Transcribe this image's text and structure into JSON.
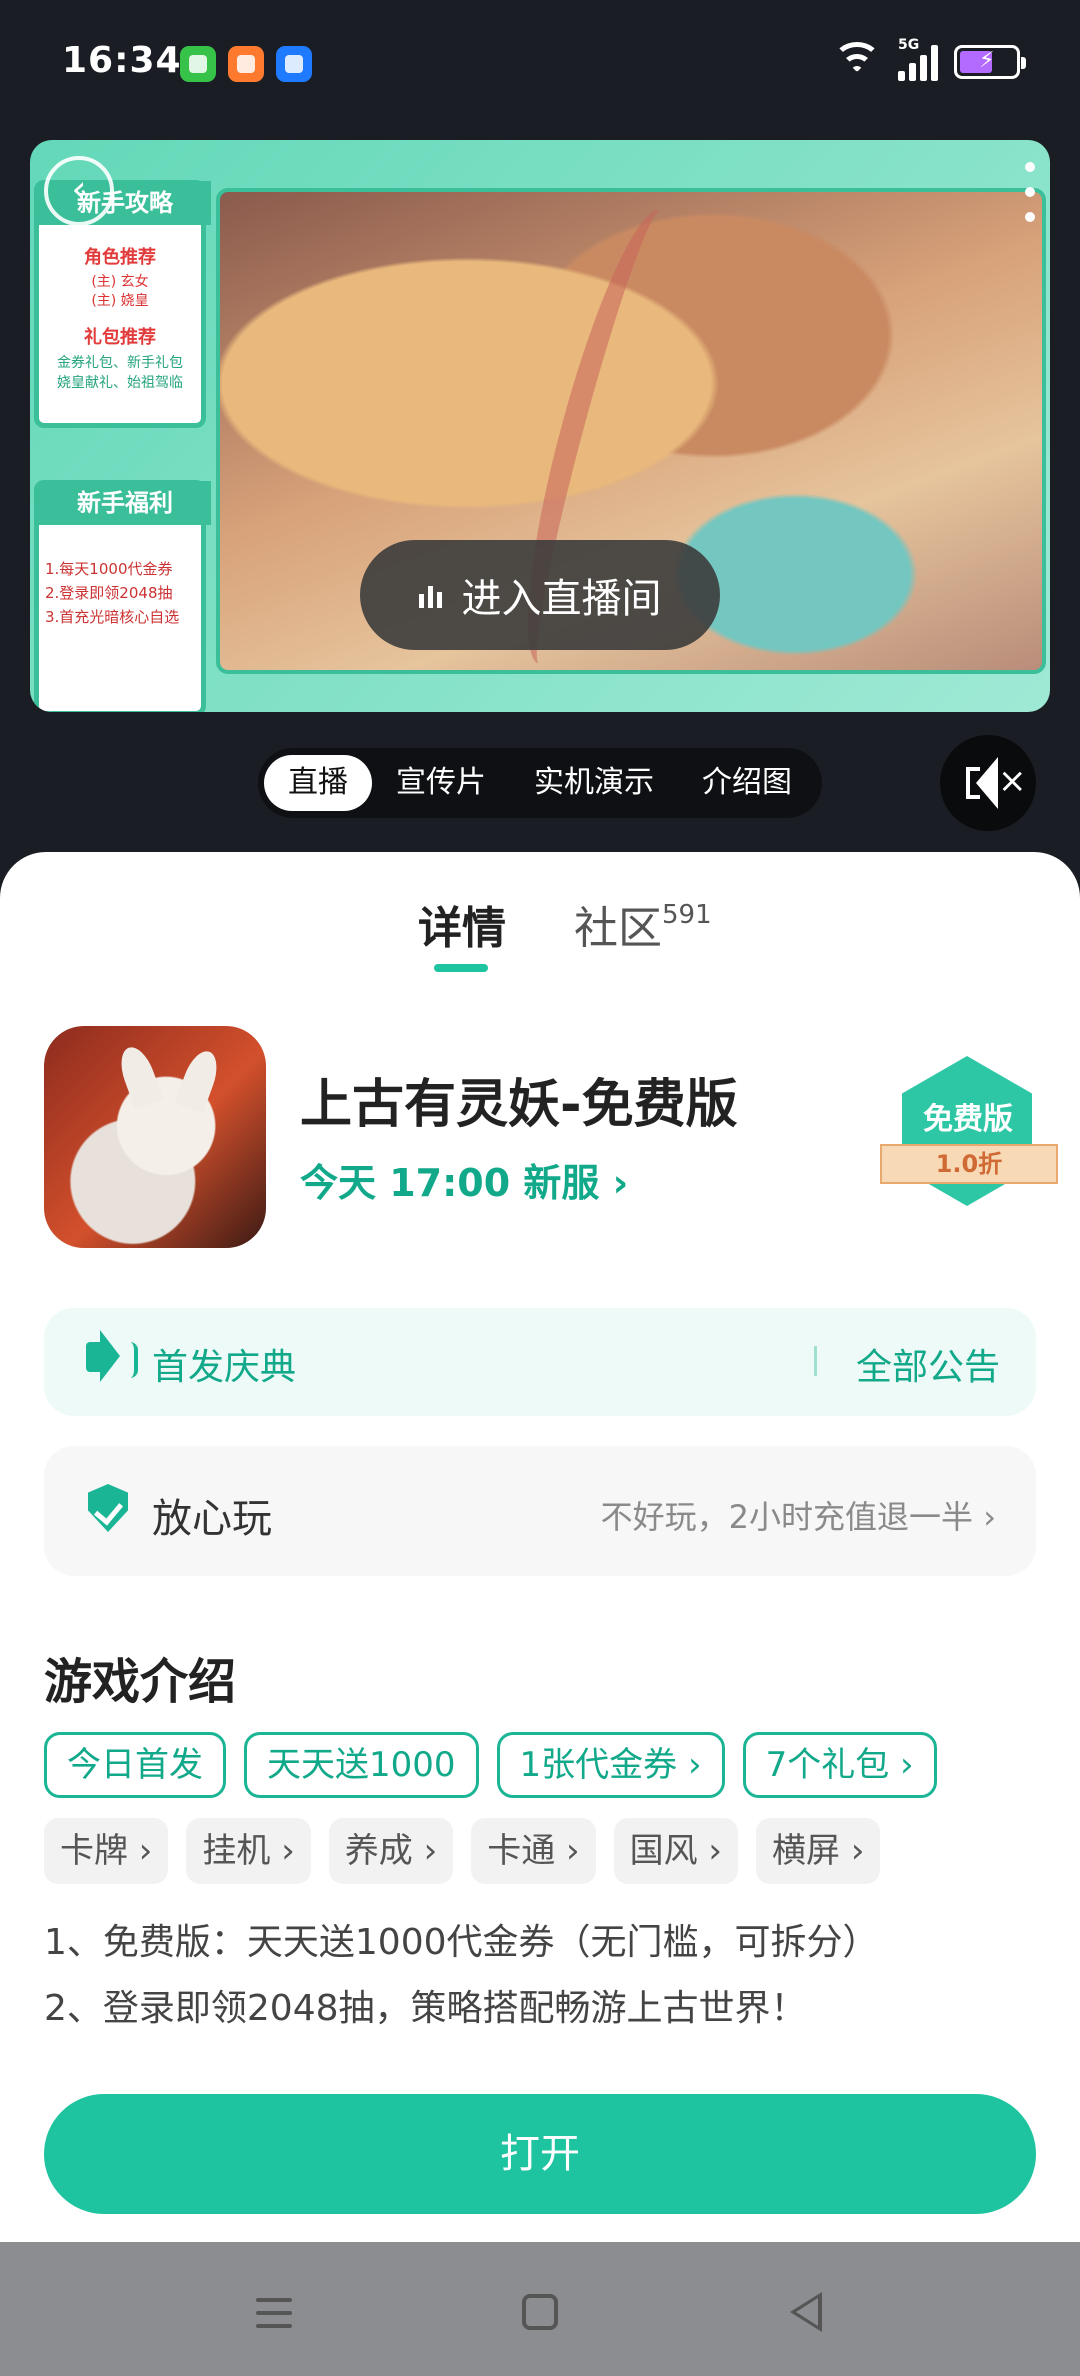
{
  "status_bar": {
    "time": "16:34",
    "notifications": [
      "message-icon",
      "app-icon",
      "phone-icon"
    ],
    "network_label": "5G",
    "battery_level": 0.6
  },
  "media": {
    "left_panel": {
      "guide_title": "新手攻略",
      "role_heading": "角色推荐",
      "role_lines": [
        "(主) 玄女",
        "(主) 娆皇"
      ],
      "gift_heading": "礼包推荐",
      "gift_lines": [
        "金券礼包、新手礼包",
        "娆皇献礼、始祖驾临"
      ],
      "welfare_title": "新手福利",
      "welfare_lines": [
        "1.每天1000代金券",
        "2.登录即领2048抽",
        "3.首充光暗核心自选"
      ]
    },
    "live_button_label": "进入直播间"
  },
  "media_tabs": [
    {
      "label": "直播",
      "active": true
    },
    {
      "label": "宣传片",
      "active": false
    },
    {
      "label": "实机演示",
      "active": false
    },
    {
      "label": "介绍图",
      "active": false
    }
  ],
  "sheet": {
    "tabs": {
      "detail": "详情",
      "community": "社区",
      "community_count": "591"
    },
    "app": {
      "name": "上古有灵妖-免费版",
      "subtitle": "今天 17:00 新服 ›",
      "badge_title": "免费版",
      "badge_discount": "1.0折"
    },
    "notice": {
      "text": "首发庆典",
      "all_link": "全部公告"
    },
    "safe_play": {
      "label": "放心玩",
      "desc": "不好玩，2小时充值退一半 ›"
    },
    "intro": {
      "title": "游戏介绍",
      "chips": [
        "今日首发",
        "天天送1000",
        "1张代金券 ›",
        "7个礼包 ›"
      ],
      "tags": [
        "卡牌 ›",
        "挂机 ›",
        "养成 ›",
        "卡通 ›",
        "国风 ›",
        "横屏 ›"
      ],
      "lines": [
        "1、免费版：天天送1000代金券（无门槛，可拆分）",
        "2、登录即领2048抽，策略搭配畅游上古世界！"
      ]
    },
    "open_button": "打开"
  },
  "colors": {
    "accent": "#1ec3a0",
    "accent_text": "#12a88a"
  }
}
